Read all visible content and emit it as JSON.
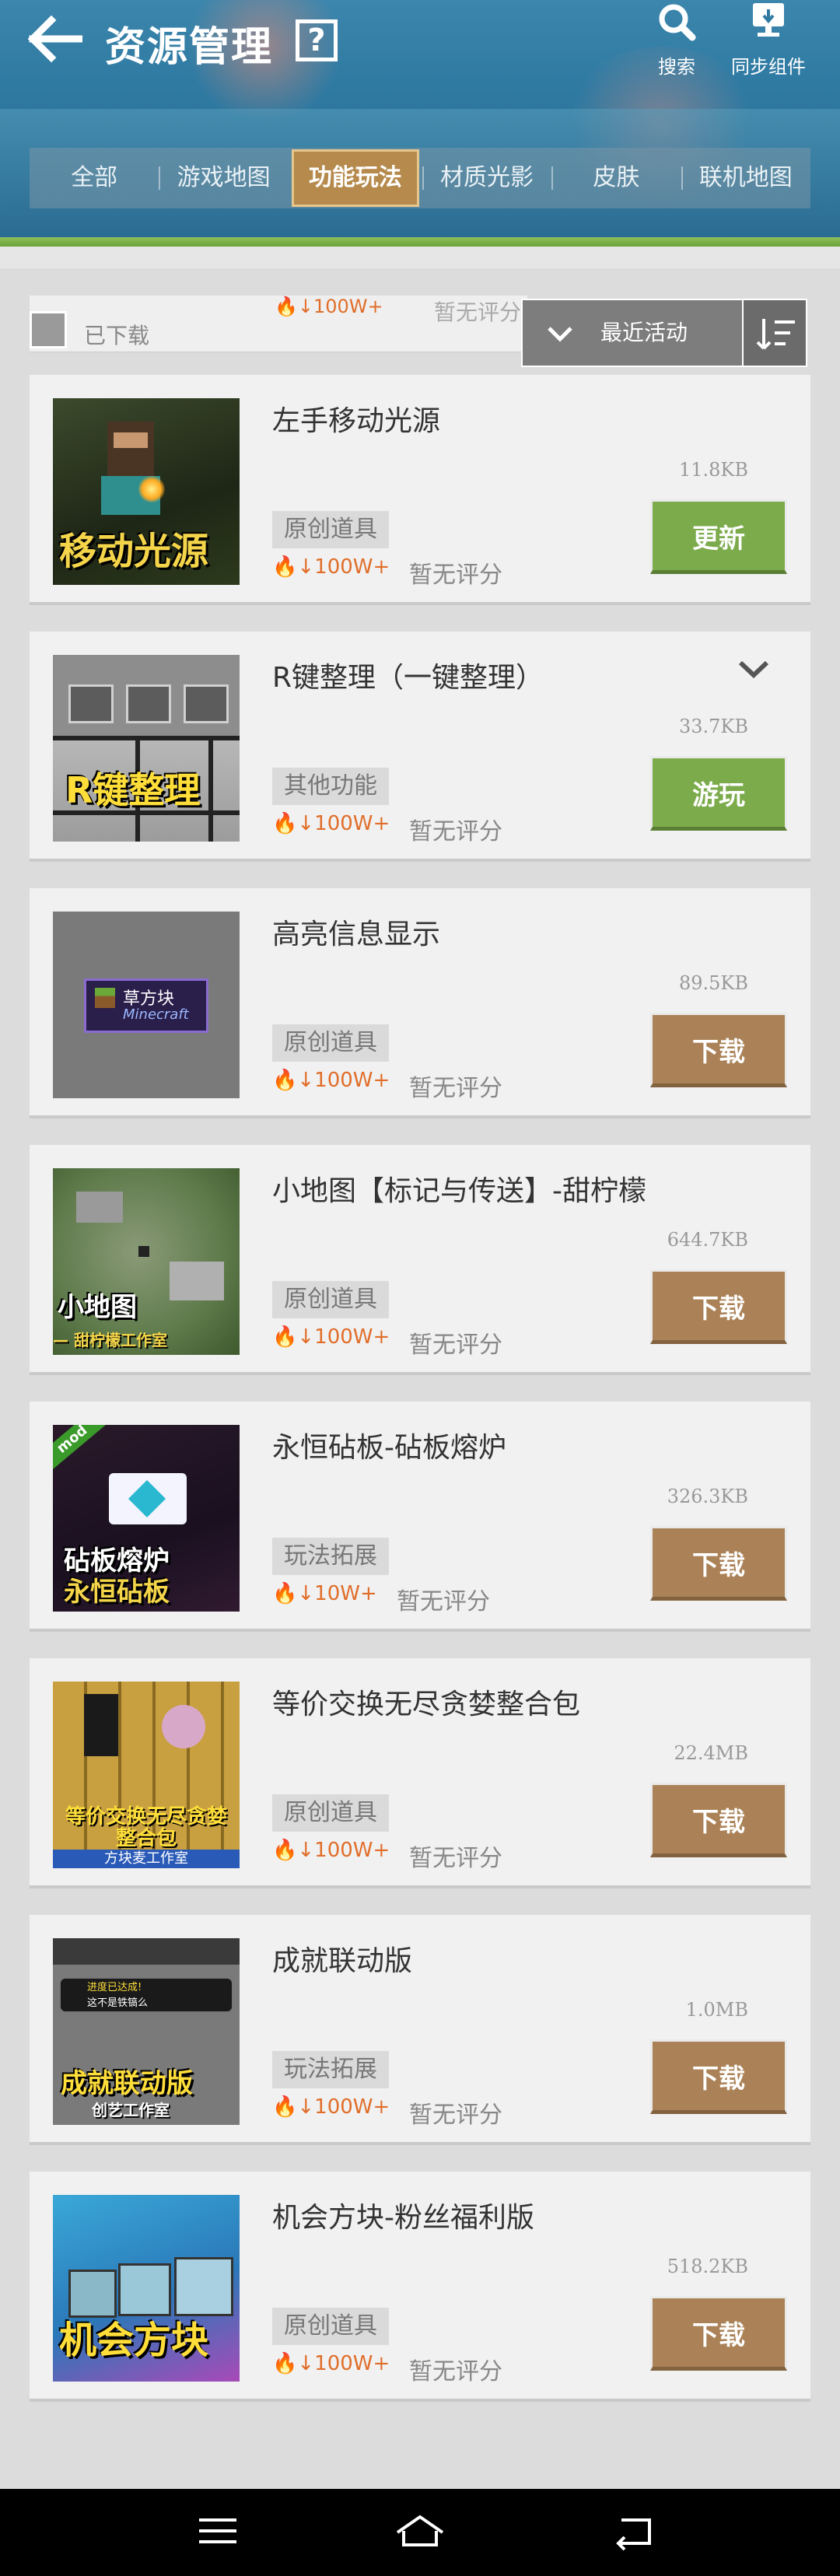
{
  "header": {
    "title": "资源管理",
    "help_glyph": "?",
    "search_label": "搜索",
    "sync_label": "同步组件"
  },
  "tabs": [
    {
      "label": "全部",
      "active": false
    },
    {
      "label": "游戏地图",
      "active": false
    },
    {
      "label": "功能玩法",
      "active": true
    },
    {
      "label": "材质光影",
      "active": false
    },
    {
      "label": "皮肤",
      "active": false
    },
    {
      "label": "联机地图",
      "active": false
    }
  ],
  "filter": {
    "partial_item": {
      "downloaded_label": "已下载",
      "downloads": "100W+",
      "rating": "暂无评分"
    },
    "sort_label": "最近活动"
  },
  "items": [
    {
      "name": "左手移动光源",
      "size": "11.8KB",
      "category": "原创道具",
      "downloads": "100W+",
      "rating": "暂无评分",
      "action": "更新",
      "thumb_caption": "移动光源"
    },
    {
      "name": "R键整理（一键整理）",
      "size": "33.7KB",
      "category": "其他功能",
      "downloads": "100W+",
      "rating": "暂无评分",
      "action": "游玩",
      "thumb_caption": "R键整理"
    },
    {
      "name": "高亮信息显示",
      "size": "89.5KB",
      "category": "原创道具",
      "downloads": "100W+",
      "rating": "暂无评分",
      "action": "下载",
      "thumb_caption": "草方块",
      "thumb_sub": "Minecraft"
    },
    {
      "name": "小地图【标记与传送】-甜柠檬",
      "size": "644.7KB",
      "category": "原创道具",
      "downloads": "100W+",
      "rating": "暂无评分",
      "action": "下载",
      "thumb_caption": "小地图",
      "thumb_sub": "— 甜柠檬工作室"
    },
    {
      "name": "永恒砧板-砧板熔炉",
      "size": "326.3KB",
      "category": "玩法拓展",
      "downloads": "10W+",
      "rating": "暂无评分",
      "action": "下载",
      "thumb_caption": "砧板熔炉",
      "thumb_sub": "永恒砧板",
      "thumb_badge": "mod"
    },
    {
      "name": "等价交换无尽贪婪整合包",
      "size": "22.4MB",
      "category": "原创道具",
      "downloads": "100W+",
      "rating": "暂无评分",
      "action": "下载",
      "thumb_caption": "等价交换无尽贪婪",
      "thumb_sub": "整合包",
      "thumb_sub2": "方块麦工作室"
    },
    {
      "name": "成就联动版",
      "size": "1.0MB",
      "category": "玩法拓展",
      "downloads": "100W+",
      "rating": "暂无评分",
      "action": "下载",
      "thumb_caption": "成就联动版",
      "thumb_sub": "创艺工作室",
      "thumb_toast": "进度已达成!",
      "thumb_toast2": "这不是铁镐么"
    },
    {
      "name": "机会方块-粉丝福利版",
      "size": "518.2KB",
      "category": "原创道具",
      "downloads": "100W+",
      "rating": "暂无评分",
      "action": "下载",
      "thumb_caption": "机会方块"
    }
  ],
  "colors": {
    "update": "#7cab4c",
    "download": "#ab8257",
    "active_tab": "#b58a4c",
    "downloads_text": "#e06e2a"
  }
}
